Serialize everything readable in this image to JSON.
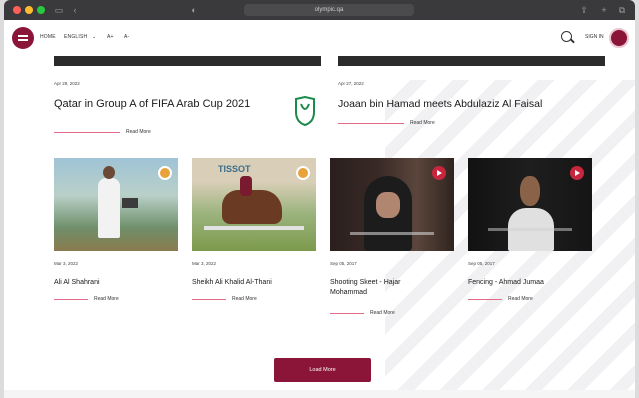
{
  "browser": {
    "url": "olympic.qa"
  },
  "header": {
    "nav": [
      "HOME",
      "ENGLISH",
      "A+",
      "A-"
    ],
    "signin": "SIGN IN"
  },
  "featured": [
    {
      "date": "Apr 29, 2022",
      "title": "Qatar in Group A of FIFA Arab Cup 2021",
      "read_more": "Read More"
    },
    {
      "date": "Apr 27, 2022",
      "title": "Joaan bin Hamad meets Abdulaziz Al Faisal",
      "read_more": "Read More"
    }
  ],
  "cards": [
    {
      "date": "Mar 3, 2022",
      "title": "Ali Al Shahrani",
      "read_more": "Read More",
      "media": "photo"
    },
    {
      "date": "Mar 3, 2022",
      "title": "Sheikh Ali Khalid Al-Thani",
      "read_more": "Read More",
      "media": "photo",
      "sponsor": "TISSOT"
    },
    {
      "date": "Sep 05, 2017",
      "title": "Shooting Skeet - Hajar Mohammad",
      "read_more": "Read More",
      "media": "video"
    },
    {
      "date": "Sep 05, 2017",
      "title": "Fencing - Ahmad Jumaa",
      "read_more": "Read More",
      "media": "video"
    }
  ],
  "load_more": "Load More",
  "colors": {
    "brand": "#8a1538",
    "accent_line": "#e36a89"
  }
}
